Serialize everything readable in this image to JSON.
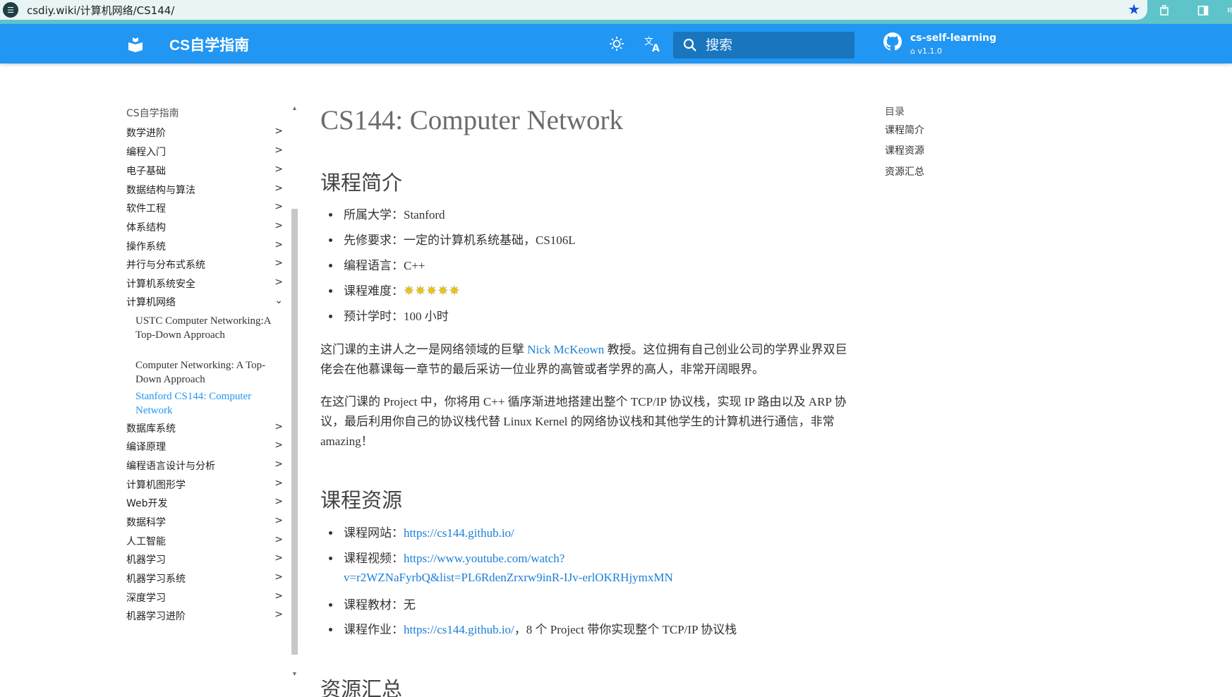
{
  "browser": {
    "url": "csdiy.wiki/计算机网络/CS144/",
    "profile": "R"
  },
  "header": {
    "site_title": "CS自学指南",
    "search_placeholder": "搜索",
    "repo_name": "cs-self-learning",
    "repo_version": "v1.1.0"
  },
  "sidebar": {
    "title": "CS自学指南",
    "items": [
      {
        "label": "数学进阶"
      },
      {
        "label": "编程入门"
      },
      {
        "label": "电子基础"
      },
      {
        "label": "数据结构与算法"
      },
      {
        "label": "软件工程"
      },
      {
        "label": "体系结构"
      },
      {
        "label": "操作系统"
      },
      {
        "label": "并行与分布式系统"
      },
      {
        "label": "计算机系统安全"
      },
      {
        "label": "计算机网络"
      },
      {
        "label": "数据库系统"
      },
      {
        "label": "编译原理"
      },
      {
        "label": "编程语言设计与分析"
      },
      {
        "label": "计算机图形学"
      },
      {
        "label": "Web开发"
      },
      {
        "label": "数据科学"
      },
      {
        "label": "人工智能"
      },
      {
        "label": "机器学习"
      },
      {
        "label": "机器学习系统"
      },
      {
        "label": "深度学习"
      },
      {
        "label": "机器学习进阶"
      }
    ],
    "subitems": [
      {
        "label": "USTC Computer Networking:A Top-Down Approach"
      },
      {
        "label": "Computer Networking: A Top-Down Approach"
      },
      {
        "label": "Stanford CS144: Computer Network"
      }
    ]
  },
  "content": {
    "title": "CS144: Computer Network",
    "intro_heading": "课程简介",
    "facts": {
      "university": "所属大学：Stanford",
      "prereq": "先修要求：一定的计算机系统基础，CS106L",
      "language": "编程语言：C++",
      "difficulty_label": "课程难度：",
      "difficulty_stars": "✷✷✷✷✷",
      "difficulty_rating": 5,
      "hours": "预计学时：100 小时"
    },
    "para1_a": "这门课的主讲人之一是网络领域的巨擘 ",
    "para1_link": "Nick McKeown",
    "para1_b": " 教授。这位拥有自己创业公司的学界业界双巨佬会在他慕课每一章节的最后采访一位业界的高管或者学界的高人，非常开阔眼界。",
    "para2": "在这门课的 Project 中，你将用 C++ 循序渐进地搭建出整个 TCP/IP 协议栈，实现 IP 路由以及 ARP 协议，最后利用你自己的协议栈代替 Linux Kernel 的网络协议栈和其他学生的计算机进行通信，非常 amazing！",
    "resources_heading": "课程资源",
    "resources": {
      "website_label": "课程网站：",
      "website_link": "https://cs144.github.io/",
      "video_label": "课程视频：",
      "video_link_a": "https://www.youtube.com/watch?",
      "video_link_b": "v=r2WZNaFyrbQ&list=PL6RdenZrxrw9inR-IJv-erlOKRHjymxMN",
      "textbook": "课程教材：无",
      "assignment_label": "课程作业：",
      "assignment_link": "https://cs144.github.io/",
      "assignment_tail": "，8 个 Project 带你实现整个 TCP/IP 协议栈"
    },
    "summary_heading": "资源汇总"
  },
  "toc": {
    "title": "目录",
    "items": [
      {
        "label": "课程简介"
      },
      {
        "label": "课程资源"
      },
      {
        "label": "资源汇总"
      }
    ]
  },
  "colors": {
    "header": "#2196f3",
    "link": "#1a7fd6",
    "browser_bar": "#5fc4c9"
  }
}
